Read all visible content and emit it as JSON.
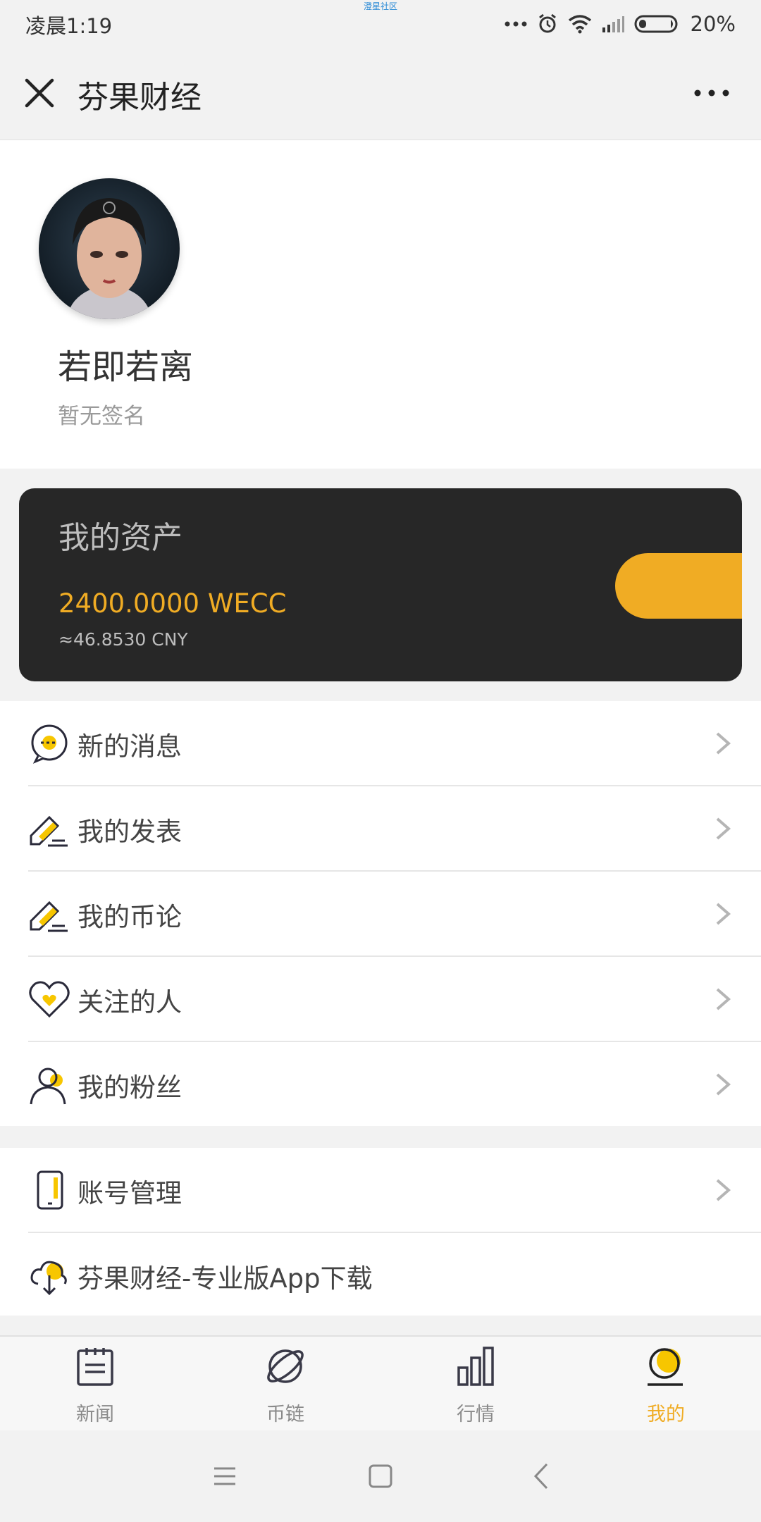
{
  "status_bar": {
    "time": "凌晨1:19",
    "center_text": "澄星社区",
    "battery": "20%"
  },
  "title_bar": {
    "title": "芬果财经"
  },
  "profile": {
    "name": "若即若离",
    "signature": "暂无签名"
  },
  "assets": {
    "title": "我的资产",
    "amount": "2400.0000 WECC",
    "cny": "≈46.8530 CNY"
  },
  "menu": [
    {
      "label": "新的消息",
      "icon": "message-icon"
    },
    {
      "label": "我的发表",
      "icon": "edit-icon"
    },
    {
      "label": "我的币论",
      "icon": "edit-icon"
    },
    {
      "label": "关注的人",
      "icon": "heart-icon"
    },
    {
      "label": "我的粉丝",
      "icon": "user-icon"
    }
  ],
  "menu2": [
    {
      "label": "账号管理",
      "icon": "phone-icon"
    },
    {
      "label": "芬果财经-专业版App下载",
      "icon": "download-cloud-icon"
    }
  ],
  "tabs": [
    {
      "label": "新闻",
      "icon": "news-icon"
    },
    {
      "label": "币链",
      "icon": "planet-icon"
    },
    {
      "label": "行情",
      "icon": "bar-chart-icon"
    },
    {
      "label": "我的",
      "icon": "me-icon"
    }
  ],
  "colors": {
    "accent": "#f0ac24",
    "card_bg": "#272727",
    "page_bg": "#f2f2f2"
  }
}
